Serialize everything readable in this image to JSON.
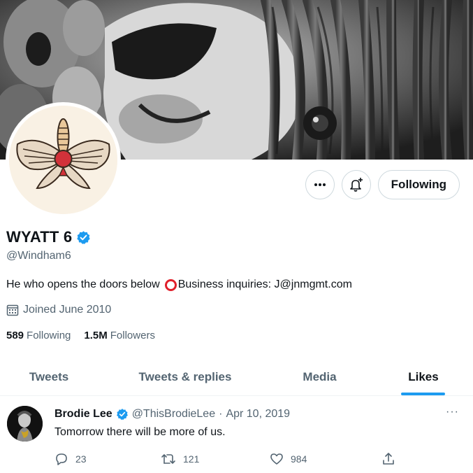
{
  "profile": {
    "display_name": "WYATT 6",
    "handle": "@Windham6",
    "bio_part1": "He who opens the doors below",
    "bio_part2": "Business inquiries: J@jnmgmt.com",
    "joined": "Joined June 2010",
    "following_count": "589",
    "following_label": "Following",
    "followers_count": "1.5M",
    "followers_label": "Followers"
  },
  "buttons": {
    "more_label": "More",
    "notify_label": "Notifications",
    "follow_label": "Following"
  },
  "tabs": [
    {
      "label": "Tweets",
      "active": false
    },
    {
      "label": "Tweets & replies",
      "active": false
    },
    {
      "label": "Media",
      "active": false
    },
    {
      "label": "Likes",
      "active": true
    }
  ],
  "tweet": {
    "author_name": "Brodie Lee",
    "author_handle": "@ThisBrodieLee",
    "separator": "·",
    "date": "Apr 10, 2019",
    "more": "···",
    "text": "Tomorrow there will be more of us.",
    "replies": "23",
    "retweets": "121",
    "likes": "984"
  },
  "colors": {
    "accent": "#1d9bf0",
    "bio_circle": "#e0202b",
    "muted_text": "#536471",
    "primary_text": "#0f1419"
  },
  "icons": [
    "more-icon",
    "notification-bell-plus-icon",
    "verified-badge-icon",
    "calendar-icon",
    "reply-icon",
    "retweet-icon",
    "like-icon",
    "share-icon"
  ]
}
